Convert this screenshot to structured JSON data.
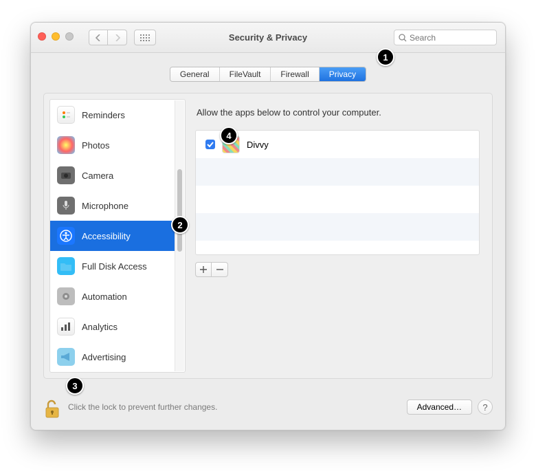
{
  "window": {
    "title": "Security & Privacy"
  },
  "search": {
    "placeholder": "Search"
  },
  "tabs": {
    "items": [
      "General",
      "FileVault",
      "Firewall",
      "Privacy"
    ],
    "active_index": 3
  },
  "sidebar": {
    "items": [
      {
        "label": "Reminders",
        "icon": "reminders-icon"
      },
      {
        "label": "Photos",
        "icon": "photos-icon"
      },
      {
        "label": "Camera",
        "icon": "camera-icon"
      },
      {
        "label": "Microphone",
        "icon": "microphone-icon"
      },
      {
        "label": "Accessibility",
        "icon": "accessibility-icon"
      },
      {
        "label": "Full Disk Access",
        "icon": "folder-icon"
      },
      {
        "label": "Automation",
        "icon": "gear-icon"
      },
      {
        "label": "Analytics",
        "icon": "chart-icon"
      },
      {
        "label": "Advertising",
        "icon": "megaphone-icon"
      }
    ],
    "active_index": 4
  },
  "detail": {
    "instruction": "Allow the apps below to control your computer.",
    "apps": [
      {
        "name": "Divvy",
        "checked": true
      }
    ]
  },
  "footer": {
    "message": "Click the lock to prevent further changes.",
    "advanced_label": "Advanced…"
  },
  "annotations": {
    "b1": "1",
    "b2": "2",
    "b3": "3",
    "b4": "4"
  }
}
